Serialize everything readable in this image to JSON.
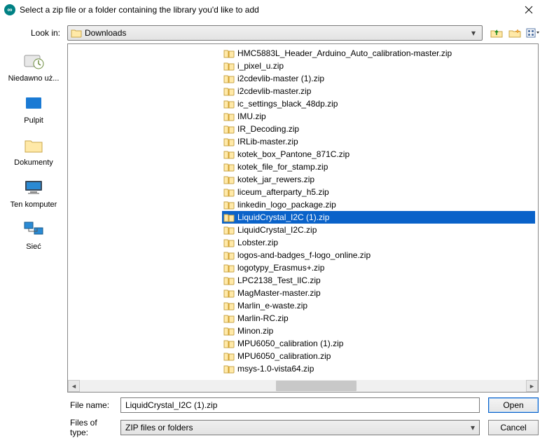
{
  "window": {
    "title": "Select a zip file or a folder containing the library you'd like to add"
  },
  "lookin": {
    "label": "Look in:",
    "value": "Downloads"
  },
  "places": [
    {
      "id": "recent",
      "label": "Niedawno uż..."
    },
    {
      "id": "desktop",
      "label": "Pulpit"
    },
    {
      "id": "docs",
      "label": "Dokumenty"
    },
    {
      "id": "thispc",
      "label": "Ten komputer"
    },
    {
      "id": "network",
      "label": "Sieć"
    }
  ],
  "files": [
    {
      "name": "HMC5883L_Header_Arduino_Auto_calibration-master.zip"
    },
    {
      "name": "i_pixel_u.zip"
    },
    {
      "name": "i2cdevlib-master (1).zip"
    },
    {
      "name": "i2cdevlib-master.zip"
    },
    {
      "name": "ic_settings_black_48dp.zip"
    },
    {
      "name": "IMU.zip"
    },
    {
      "name": "IR_Decoding.zip"
    },
    {
      "name": "IRLib-master.zip"
    },
    {
      "name": "kotek_box_Pantone_871C.zip"
    },
    {
      "name": "kotek_file_for_stamp.zip"
    },
    {
      "name": "kotek_jar_rewers.zip"
    },
    {
      "name": "liceum_afterparty_h5.zip"
    },
    {
      "name": "linkedin_logo_package.zip"
    },
    {
      "name": "LiquidCrystal_I2C (1).zip",
      "selected": true
    },
    {
      "name": "LiquidCrystal_I2C.zip"
    },
    {
      "name": "Lobster.zip"
    },
    {
      "name": "logos-and-badges_f-logo_online.zip"
    },
    {
      "name": "logotypy_Erasmus+.zip"
    },
    {
      "name": "LPC2138_Test_lIC.zip"
    },
    {
      "name": "MagMaster-master.zip"
    },
    {
      "name": "Marlin_e-waste.zip"
    },
    {
      "name": "Marlin-RC.zip"
    },
    {
      "name": "Minon.zip"
    },
    {
      "name": "MPU6050_calibration (1).zip"
    },
    {
      "name": "MPU6050_calibration.zip"
    },
    {
      "name": "msys-1.0-vista64.zip"
    }
  ],
  "filename": {
    "label": "File name:",
    "value": "LiquidCrystal_I2C (1).zip"
  },
  "filetype": {
    "label": "Files of type:",
    "value": "ZIP files or folders"
  },
  "buttons": {
    "open": "Open",
    "cancel": "Cancel"
  }
}
